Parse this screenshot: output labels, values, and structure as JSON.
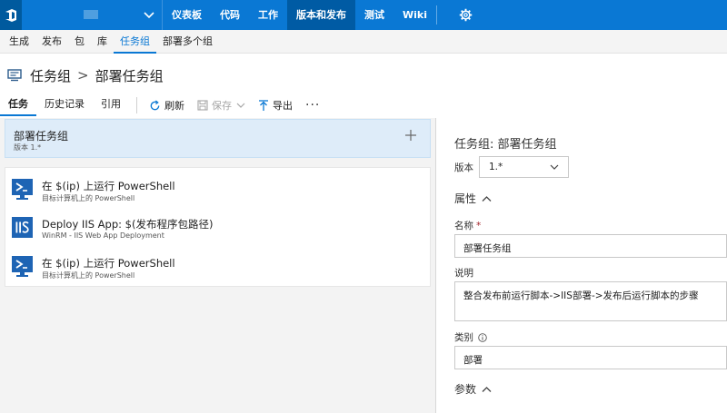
{
  "topbar": {
    "nav": [
      {
        "label": "仪表板"
      },
      {
        "label": "代码"
      },
      {
        "label": "工作"
      },
      {
        "label": "版本和发布",
        "active": true
      },
      {
        "label": "测试"
      },
      {
        "label": "Wiki"
      }
    ],
    "icons": {
      "logo": "vsts-logo-icon",
      "project_chevron": "chevron-down-icon",
      "settings": "gear-icon"
    }
  },
  "subnav": {
    "items": [
      {
        "label": "生成"
      },
      {
        "label": "发布"
      },
      {
        "label": "包"
      },
      {
        "label": "库"
      },
      {
        "label": "任务组",
        "active": true
      },
      {
        "label": "部署多个组"
      }
    ]
  },
  "breadcrumb": {
    "parent": "任务组",
    "current": "部署任务组"
  },
  "toolbar": {
    "tabs": [
      "任务",
      "历史记录",
      "引用"
    ],
    "refresh": "刷新",
    "save": "保存",
    "export": "导出",
    "more": "···"
  },
  "left_panel": {
    "group_name": "部署任务组",
    "group_version": "版本 1.*",
    "tasks": [
      {
        "name": "在 $(ip) 上运行 PowerShell",
        "subtitle": "目标计算机上的 PowerShell",
        "icon": "powershell-icon"
      },
      {
        "name": "Deploy IIS App: $(发布程序包路径)",
        "subtitle": "WinRM - IIS Web App Deployment",
        "icon": "iis-icon"
      },
      {
        "name": "在 $(ip) 上运行 PowerShell",
        "subtitle": "目标计算机上的 PowerShell",
        "icon": "powershell-icon"
      }
    ]
  },
  "right_panel": {
    "title": "任务组: 部署任务组",
    "version_label": "版本",
    "version_value": "1.*",
    "properties_section": "属性",
    "name_label": "名称",
    "name_required": "*",
    "name_value": "部署任务组",
    "description_label": "说明",
    "description_value": "整合发布前运行脚本->IIS部署->发布后运行脚本的步骤",
    "category_label": "类别",
    "category_value": "部署",
    "params_section": "参数"
  },
  "colors": {
    "accent": "#0a78d4",
    "topbar": "#0a78d4",
    "active_nav": "#005ba4",
    "selected_row": "#deecf9",
    "powershell_icon": "#1e64b4",
    "iis_icon": "#1e64b4"
  }
}
